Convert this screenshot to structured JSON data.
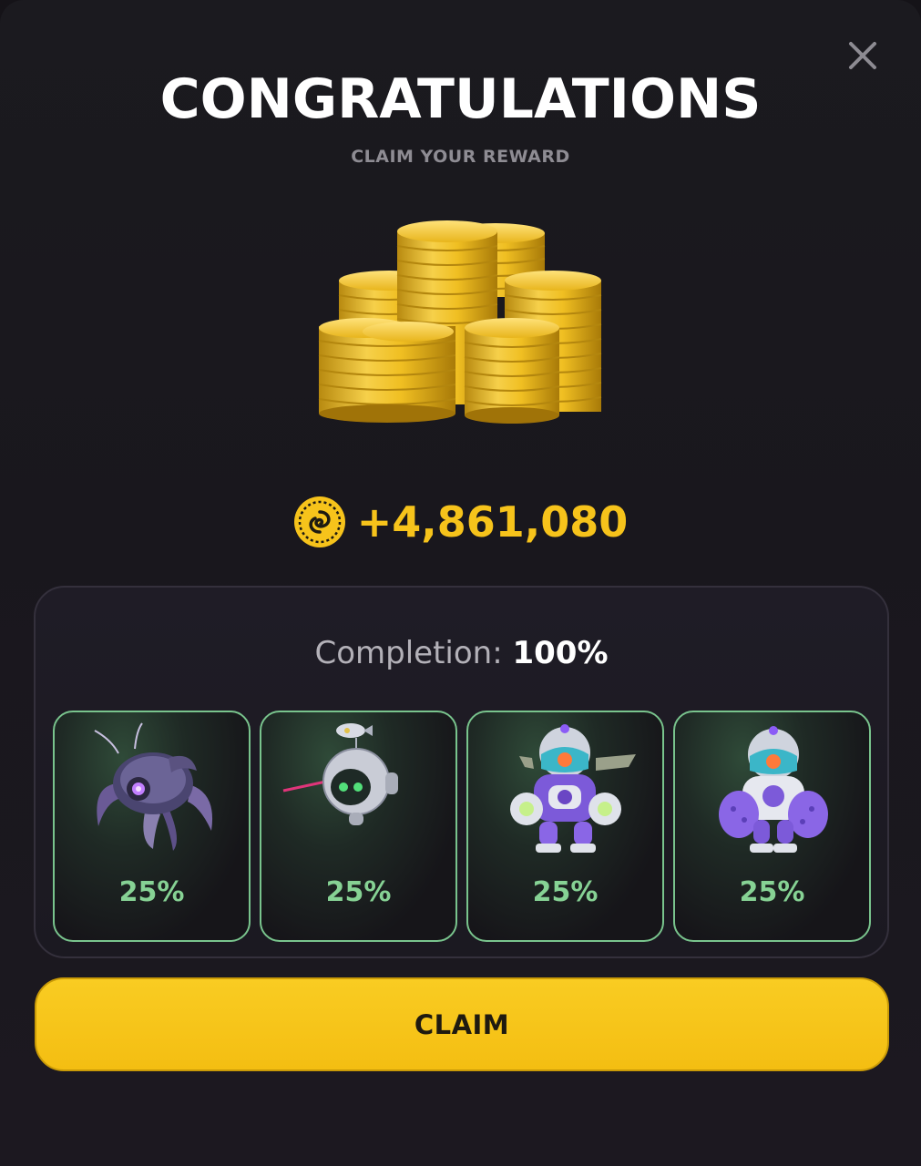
{
  "modal": {
    "title": "CONGRATULATIONS",
    "subtitle": "CLAIM YOUR REWARD",
    "close_icon": "close-icon"
  },
  "reward": {
    "amount": "+4,861,080",
    "currency_icon": "coin-icon",
    "art_icon": "gold-coin-stacks-icon"
  },
  "completion": {
    "label": "Completion:",
    "value": "100%",
    "characters": [
      {
        "icon": "spider-bot-icon",
        "percent": "25%"
      },
      {
        "icon": "drone-bot-icon",
        "percent": "25%"
      },
      {
        "icon": "winged-mech-icon",
        "percent": "25%"
      },
      {
        "icon": "heavy-mech-icon",
        "percent": "25%"
      }
    ]
  },
  "actions": {
    "claim_label": "CLAIM"
  },
  "colors": {
    "accent": "#f6c31b",
    "button": "#f7c51a",
    "card_border": "#79c48d",
    "percent": "#86d294",
    "background": "#1a181e"
  }
}
